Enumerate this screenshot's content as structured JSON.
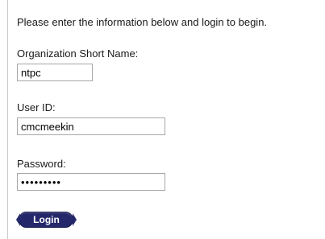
{
  "intro_text": "Please enter the information below and login to begin.",
  "form": {
    "org_label": "Organization Short Name:",
    "org_value": "ntpc",
    "user_label": "User ID:",
    "user_value": "cmcmeekin",
    "password_label": "Password:",
    "password_value": "•••••••••",
    "login_label": "Login"
  },
  "colors": {
    "button": "#24286a",
    "field_border": "#a7a7a7",
    "panel_border": "#c9c9c9"
  }
}
